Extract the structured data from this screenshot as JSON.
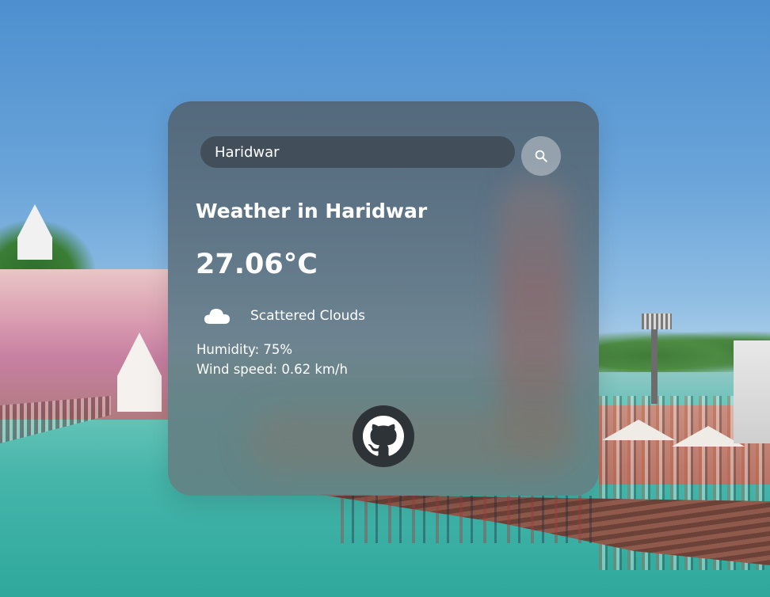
{
  "search": {
    "value": "Haridwar",
    "button_icon": "search-icon"
  },
  "weather": {
    "title": "Weather in Haridwar",
    "temperature": "27.06°C",
    "condition_icon": "cloud-icon",
    "description": "Scattered Clouds",
    "humidity": "Humidity: 75%",
    "wind": "Wind speed: 0.62 km/h"
  },
  "footer": {
    "link_icon": "github-icon"
  },
  "colors": {
    "card_tint": "#52626f",
    "search_field": "#3c4650",
    "github_circle": "#2e3338",
    "text": "#ffffff"
  }
}
